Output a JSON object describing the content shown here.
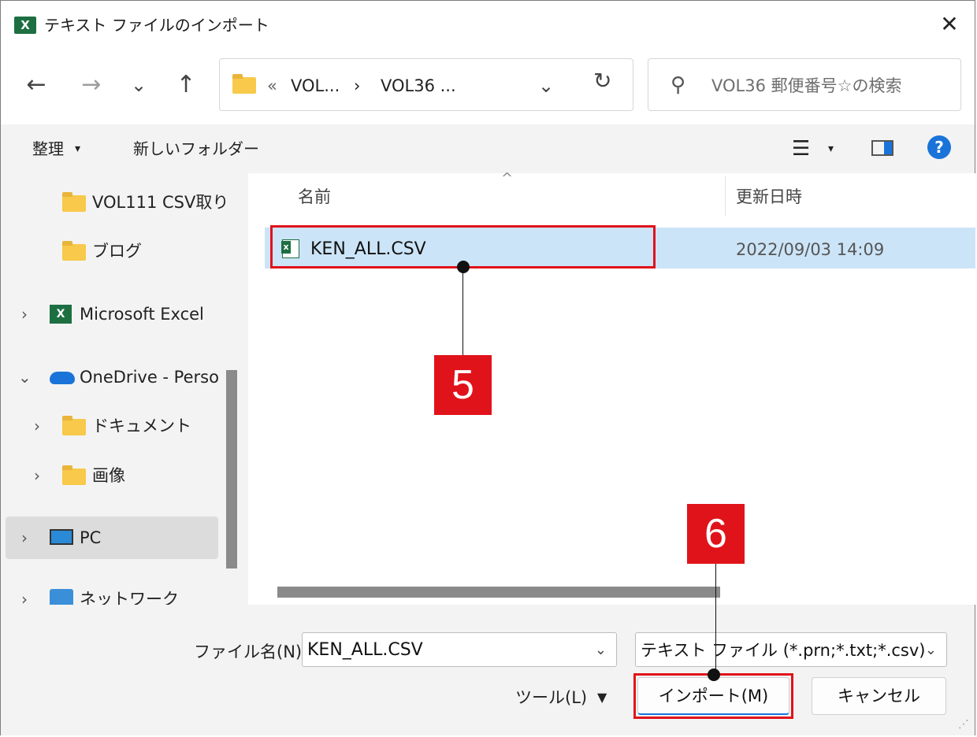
{
  "window": {
    "title": "テキスト ファイルのインポート",
    "app_icon_letter": "X"
  },
  "nav": {
    "back_icon": "←",
    "forward_icon": "→",
    "recent_icon": "⌄",
    "up_icon": "↑"
  },
  "address": {
    "overflow": "«",
    "crumbs": [
      "VOL...",
      "VOL36 ..."
    ],
    "separator": "›",
    "dropdown_icon": "⌄",
    "refresh_icon": "↻"
  },
  "search": {
    "icon": "⚲",
    "placeholder": "VOL36 郵便番号☆の検索"
  },
  "toolbar": {
    "organize_label": "整理",
    "new_folder_label": "新しいフォルダー",
    "view_icon": "☰",
    "dropdown_arrow": "▾",
    "help_icon": "?"
  },
  "sidebar": {
    "items": [
      {
        "label": "VOL111 CSV取り",
        "icon": "folder-icon"
      },
      {
        "label": "ブログ",
        "icon": "folder-icon"
      },
      {
        "label": "Microsoft Excel",
        "icon": "excel-icon"
      },
      {
        "label": "OneDrive - Perso",
        "icon": "onedrive-icon"
      },
      {
        "label": "ドキュメント",
        "icon": "folder-icon"
      },
      {
        "label": "画像",
        "icon": "folder-icon"
      },
      {
        "label": "PC",
        "icon": "pc-icon"
      },
      {
        "label": "ネットワーク",
        "icon": "network-icon"
      }
    ],
    "chevron_collapsed": "›",
    "chevron_expanded": "⌄"
  },
  "file_list": {
    "columns": [
      "名前",
      "更新日時"
    ],
    "sort_indicator": "^",
    "rows": [
      {
        "name": "KEN_ALL.CSV",
        "modified": "2022/09/03 14:09",
        "selected": true
      }
    ]
  },
  "callouts": {
    "step5": "5",
    "step6": "6"
  },
  "bottom": {
    "filename_label": "ファイル名(N):",
    "filename_value": "KEN_ALL.CSV",
    "filetype_value": "テキスト ファイル (*.prn;*.txt;*.csv)",
    "tools_label": "ツール(L)",
    "tools_arrow": "▼",
    "import_label": "インポート(M)",
    "cancel_label": "キャンセル",
    "dropdown_icon": "⌄"
  },
  "colors": {
    "accent": "#1a73d9",
    "highlight_red": "#e0131a",
    "selection": "#cce4f7",
    "excel_green": "#1d6f42"
  }
}
